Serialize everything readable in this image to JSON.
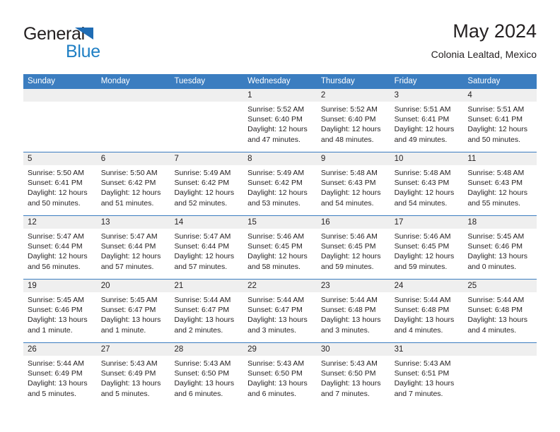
{
  "brand": {
    "name_part1": "General",
    "name_part2": "Blue",
    "accent_color": "#1f7fc4",
    "triangle_color": "#1f6cb4"
  },
  "header": {
    "title": "May 2024",
    "subtitle": "Colonia Lealtad, Mexico"
  },
  "calendar": {
    "header_bg": "#3b7dc0",
    "day_strip_bg": "#efefef",
    "weekdays": [
      "Sunday",
      "Monday",
      "Tuesday",
      "Wednesday",
      "Thursday",
      "Friday",
      "Saturday"
    ],
    "weeks": [
      [
        {
          "day": "",
          "lines": []
        },
        {
          "day": "",
          "lines": []
        },
        {
          "day": "",
          "lines": []
        },
        {
          "day": "1",
          "lines": [
            "Sunrise: 5:52 AM",
            "Sunset: 6:40 PM",
            "Daylight: 12 hours",
            "and 47 minutes."
          ]
        },
        {
          "day": "2",
          "lines": [
            "Sunrise: 5:52 AM",
            "Sunset: 6:40 PM",
            "Daylight: 12 hours",
            "and 48 minutes."
          ]
        },
        {
          "day": "3",
          "lines": [
            "Sunrise: 5:51 AM",
            "Sunset: 6:41 PM",
            "Daylight: 12 hours",
            "and 49 minutes."
          ]
        },
        {
          "day": "4",
          "lines": [
            "Sunrise: 5:51 AM",
            "Sunset: 6:41 PM",
            "Daylight: 12 hours",
            "and 50 minutes."
          ]
        }
      ],
      [
        {
          "day": "5",
          "lines": [
            "Sunrise: 5:50 AM",
            "Sunset: 6:41 PM",
            "Daylight: 12 hours",
            "and 50 minutes."
          ]
        },
        {
          "day": "6",
          "lines": [
            "Sunrise: 5:50 AM",
            "Sunset: 6:42 PM",
            "Daylight: 12 hours",
            "and 51 minutes."
          ]
        },
        {
          "day": "7",
          "lines": [
            "Sunrise: 5:49 AM",
            "Sunset: 6:42 PM",
            "Daylight: 12 hours",
            "and 52 minutes."
          ]
        },
        {
          "day": "8",
          "lines": [
            "Sunrise: 5:49 AM",
            "Sunset: 6:42 PM",
            "Daylight: 12 hours",
            "and 53 minutes."
          ]
        },
        {
          "day": "9",
          "lines": [
            "Sunrise: 5:48 AM",
            "Sunset: 6:43 PM",
            "Daylight: 12 hours",
            "and 54 minutes."
          ]
        },
        {
          "day": "10",
          "lines": [
            "Sunrise: 5:48 AM",
            "Sunset: 6:43 PM",
            "Daylight: 12 hours",
            "and 54 minutes."
          ]
        },
        {
          "day": "11",
          "lines": [
            "Sunrise: 5:48 AM",
            "Sunset: 6:43 PM",
            "Daylight: 12 hours",
            "and 55 minutes."
          ]
        }
      ],
      [
        {
          "day": "12",
          "lines": [
            "Sunrise: 5:47 AM",
            "Sunset: 6:44 PM",
            "Daylight: 12 hours",
            "and 56 minutes."
          ]
        },
        {
          "day": "13",
          "lines": [
            "Sunrise: 5:47 AM",
            "Sunset: 6:44 PM",
            "Daylight: 12 hours",
            "and 57 minutes."
          ]
        },
        {
          "day": "14",
          "lines": [
            "Sunrise: 5:47 AM",
            "Sunset: 6:44 PM",
            "Daylight: 12 hours",
            "and 57 minutes."
          ]
        },
        {
          "day": "15",
          "lines": [
            "Sunrise: 5:46 AM",
            "Sunset: 6:45 PM",
            "Daylight: 12 hours",
            "and 58 minutes."
          ]
        },
        {
          "day": "16",
          "lines": [
            "Sunrise: 5:46 AM",
            "Sunset: 6:45 PM",
            "Daylight: 12 hours",
            "and 59 minutes."
          ]
        },
        {
          "day": "17",
          "lines": [
            "Sunrise: 5:46 AM",
            "Sunset: 6:45 PM",
            "Daylight: 12 hours",
            "and 59 minutes."
          ]
        },
        {
          "day": "18",
          "lines": [
            "Sunrise: 5:45 AM",
            "Sunset: 6:46 PM",
            "Daylight: 13 hours",
            "and 0 minutes."
          ]
        }
      ],
      [
        {
          "day": "19",
          "lines": [
            "Sunrise: 5:45 AM",
            "Sunset: 6:46 PM",
            "Daylight: 13 hours",
            "and 1 minute."
          ]
        },
        {
          "day": "20",
          "lines": [
            "Sunrise: 5:45 AM",
            "Sunset: 6:47 PM",
            "Daylight: 13 hours",
            "and 1 minute."
          ]
        },
        {
          "day": "21",
          "lines": [
            "Sunrise: 5:44 AM",
            "Sunset: 6:47 PM",
            "Daylight: 13 hours",
            "and 2 minutes."
          ]
        },
        {
          "day": "22",
          "lines": [
            "Sunrise: 5:44 AM",
            "Sunset: 6:47 PM",
            "Daylight: 13 hours",
            "and 3 minutes."
          ]
        },
        {
          "day": "23",
          "lines": [
            "Sunrise: 5:44 AM",
            "Sunset: 6:48 PM",
            "Daylight: 13 hours",
            "and 3 minutes."
          ]
        },
        {
          "day": "24",
          "lines": [
            "Sunrise: 5:44 AM",
            "Sunset: 6:48 PM",
            "Daylight: 13 hours",
            "and 4 minutes."
          ]
        },
        {
          "day": "25",
          "lines": [
            "Sunrise: 5:44 AM",
            "Sunset: 6:48 PM",
            "Daylight: 13 hours",
            "and 4 minutes."
          ]
        }
      ],
      [
        {
          "day": "26",
          "lines": [
            "Sunrise: 5:44 AM",
            "Sunset: 6:49 PM",
            "Daylight: 13 hours",
            "and 5 minutes."
          ]
        },
        {
          "day": "27",
          "lines": [
            "Sunrise: 5:43 AM",
            "Sunset: 6:49 PM",
            "Daylight: 13 hours",
            "and 5 minutes."
          ]
        },
        {
          "day": "28",
          "lines": [
            "Sunrise: 5:43 AM",
            "Sunset: 6:50 PM",
            "Daylight: 13 hours",
            "and 6 minutes."
          ]
        },
        {
          "day": "29",
          "lines": [
            "Sunrise: 5:43 AM",
            "Sunset: 6:50 PM",
            "Daylight: 13 hours",
            "and 6 minutes."
          ]
        },
        {
          "day": "30",
          "lines": [
            "Sunrise: 5:43 AM",
            "Sunset: 6:50 PM",
            "Daylight: 13 hours",
            "and 7 minutes."
          ]
        },
        {
          "day": "31",
          "lines": [
            "Sunrise: 5:43 AM",
            "Sunset: 6:51 PM",
            "Daylight: 13 hours",
            "and 7 minutes."
          ]
        },
        {
          "day": "",
          "lines": []
        }
      ]
    ]
  }
}
